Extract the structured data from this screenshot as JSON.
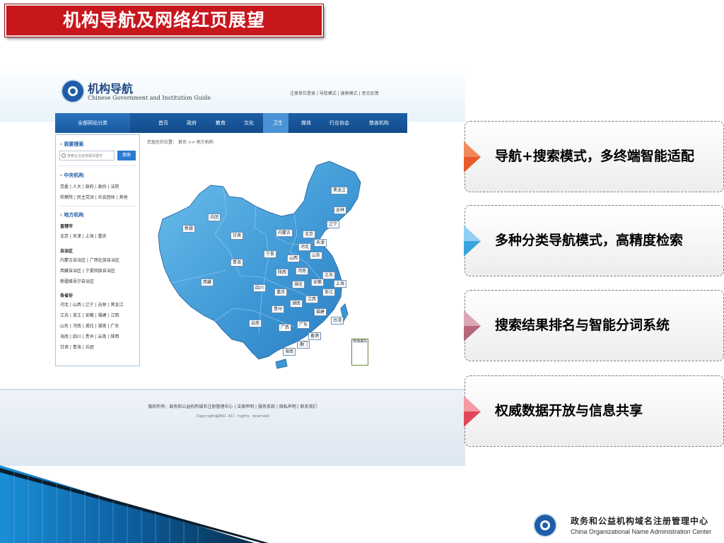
{
  "slide": {
    "title": "机构导航及网络红页展望",
    "points": [
      {
        "text": "导航+搜索模式，多终端智能适配",
        "arrow_color": "#e85a2a",
        "arrow_icon": "orange-arrow-icon"
      },
      {
        "text": "多种分类导航模式，高精度检索",
        "arrow_color": "#3aa3dc",
        "arrow_icon": "blue-arrow-icon"
      },
      {
        "text": "搜索结果排名与智能分词系统",
        "arrow_color": "#b4687a",
        "arrow_icon": "mauve-arrow-icon"
      },
      {
        "text": "权威数据开放与信息共享",
        "arrow_color": "#e04858",
        "arrow_icon": "red-arrow-icon"
      }
    ]
  },
  "screenshot": {
    "site_title_cn": "机构导航",
    "site_title_en": "Chinese Government and Institution Guide",
    "top_links": "注册单位登录 | 导航模式 | 搜索模式 | 意见反馈",
    "nav": {
      "all_categories": "全部网站分类",
      "items": [
        "首页",
        "政府",
        "教育",
        "文化",
        "卫生",
        "媒体",
        "行业协会",
        "慈善机构"
      ],
      "active_index": 2
    },
    "sidebar": {
      "search_title": "› 我要搜索",
      "search_placeholder": "搜索企业名称或关键字",
      "search_button": "搜索",
      "central_title": "› 中央机构",
      "central_line1": "党委 | 人大 | 政府 | 政协 | 法院",
      "central_line2": "检察院 | 民主党派 | 社会团体 | 其他",
      "local_title": "› 地方机构",
      "municipalities_label": "直辖市",
      "municipalities": "北京 | 天津 | 上海 | 重庆",
      "autonomous_label": "自治区",
      "autonomous_line1": "内蒙古自治区 | 广西壮族自治区",
      "autonomous_line2": "西藏自治区 | 宁夏回族自治区",
      "autonomous_line3": "新疆维吾尔自治区",
      "provinces_label": "各省份",
      "provinces_line1": "河北 | 山西 | 辽宁 | 吉林 | 黑龙江",
      "provinces_line2": "江苏 | 浙江 | 安徽 | 福建 | 江西",
      "provinces_line3": "山东 | 河南 | 湖北 | 湖南 | 广东",
      "provinces_line4": "海南 | 四川 | 贵州 | 云南 | 陕西",
      "provinces_line5": "甘肃 | 青海 | 兵团"
    },
    "breadcrumb": "您现在的位置： 首页 >> 地方机构",
    "map_labels": [
      "黑龙江",
      "吉林",
      "辽宁",
      "兵团",
      "新疆",
      "甘肃",
      "内蒙古",
      "北京",
      "天津",
      "河北",
      "山西",
      "山东",
      "宁夏",
      "青海",
      "陕西",
      "河南",
      "江苏",
      "上海",
      "西藏",
      "湖北",
      "安徽",
      "四川",
      "重庆",
      "浙江",
      "湖南",
      "江西",
      "贵州",
      "福建",
      "云南",
      "广西",
      "广东",
      "台湾",
      "香港",
      "澳门",
      "海南"
    ],
    "islands_label": "南海诸岛",
    "footer_links": "版权所有：政务和公益机构域名注册管理中心 | 法律声明 | 服务条款 | 隐私声明 | 联系我们",
    "footer_copyright": "Copyright@2011 All rights reserved"
  },
  "organization": {
    "name_cn": "政务和公益机构域名注册管理中心",
    "name_en": "China Organizational Name Administration Center"
  },
  "colors": {
    "title_red": "#c8161d",
    "nav_blue": "#1d5fa6",
    "map_blue": "#4ba3da"
  }
}
